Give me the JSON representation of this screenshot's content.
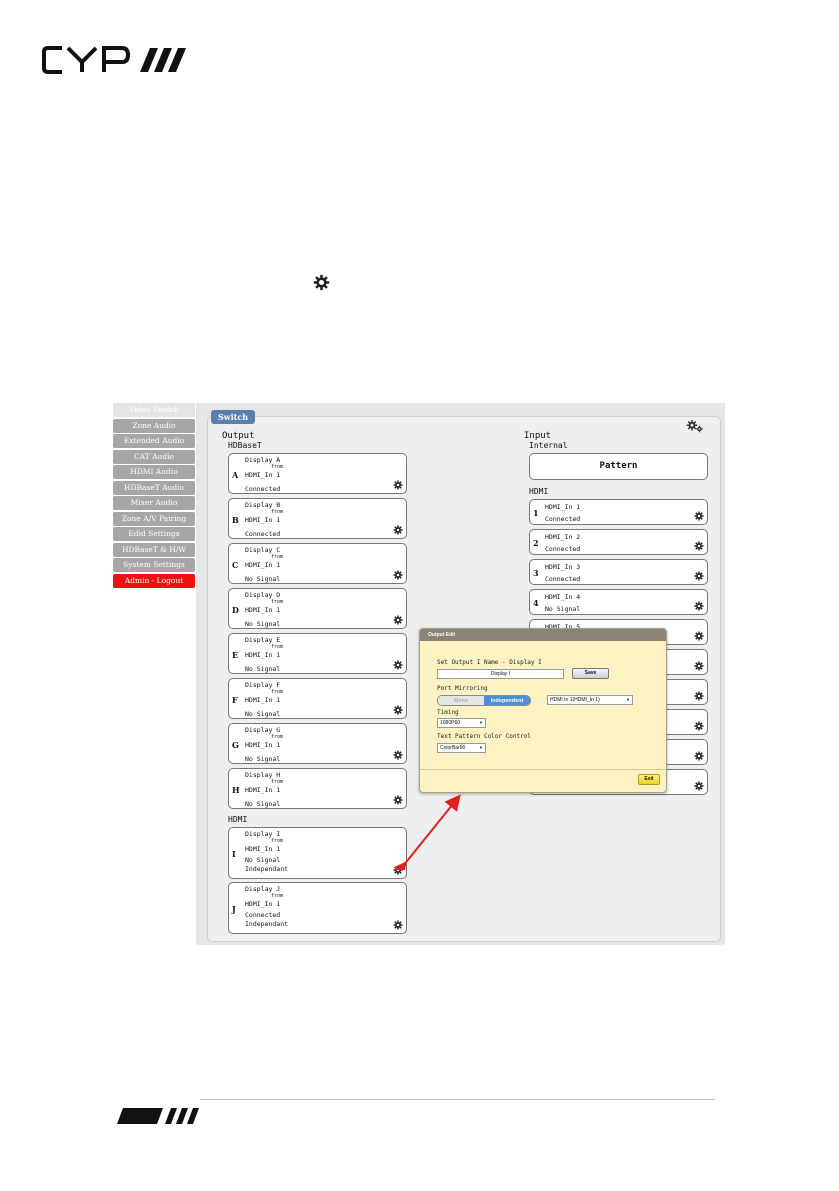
{
  "sidebar": {
    "items": [
      {
        "label": "Video Switch"
      },
      {
        "label": "Zone Audio"
      },
      {
        "label": "Extended Audio"
      },
      {
        "label": "CAT Audio"
      },
      {
        "label": "HDMI Audio"
      },
      {
        "label": "HDBaseT Audio"
      },
      {
        "label": "Mixer Audio"
      },
      {
        "label": "Zone A/V Pairing"
      },
      {
        "label": "Edid Settings"
      },
      {
        "label": "HDBaseT & H/W"
      },
      {
        "label": "System Settings"
      },
      {
        "label": "Admin - Logout"
      }
    ]
  },
  "main": {
    "tab_label": "Switch",
    "output_heading": "Output",
    "hdbaset_heading": "HDBaseT",
    "hdmi_heading": "HDMI",
    "input_heading": "Input",
    "internal_heading": "Internal",
    "input_hdmi_heading": "HDMI",
    "pattern_label": "Pattern"
  },
  "outputs": [
    {
      "letter": "A",
      "name": "Display A",
      "from": "from",
      "source": "HDMI_In 1",
      "status": "Connected",
      "mode": ""
    },
    {
      "letter": "B",
      "name": "Display B",
      "from": "from",
      "source": "HDMI_In 1",
      "status": "Connected",
      "mode": ""
    },
    {
      "letter": "C",
      "name": "Display C",
      "from": "from",
      "source": "HDMI_In 1",
      "status": "No Signal",
      "mode": ""
    },
    {
      "letter": "D",
      "name": "Display D",
      "from": "from",
      "source": "HDMI_In 1",
      "status": "No Signal",
      "mode": ""
    },
    {
      "letter": "E",
      "name": "Display E",
      "from": "from",
      "source": "HDMI_In 1",
      "status": "No Signal",
      "mode": ""
    },
    {
      "letter": "F",
      "name": "Display F",
      "from": "from",
      "source": "HDMI_In 1",
      "status": "No Signal",
      "mode": ""
    },
    {
      "letter": "G",
      "name": "Display G",
      "from": "from",
      "source": "HDMI_In 1",
      "status": "No Signal",
      "mode": ""
    },
    {
      "letter": "H",
      "name": "Display H",
      "from": "from",
      "source": "HDMI_In 1",
      "status": "No Signal",
      "mode": ""
    },
    {
      "letter": "I",
      "name": "Display I",
      "from": "from",
      "source": "HDMI_In 1",
      "status": "No Signal",
      "mode": "Independant"
    },
    {
      "letter": "J",
      "name": "Display J",
      "from": "from",
      "source": "HDMI_In 1",
      "status": "Connected",
      "mode": "Independant"
    }
  ],
  "inputs": [
    {
      "num": "1",
      "name": "HDMI_In 1",
      "status": "Connected"
    },
    {
      "num": "2",
      "name": "HDMI_In 2",
      "status": "Connected"
    },
    {
      "num": "3",
      "name": "HDMI_In 3",
      "status": "Connected"
    },
    {
      "num": "4",
      "name": "HDMI_In 4",
      "status": "No Signal"
    },
    {
      "num": "5",
      "name": "HDMI_In 5",
      "status": ""
    }
  ],
  "popup": {
    "title": "Output Edit",
    "name_label": "Set Output I Name - Display I",
    "name_value": "Display I",
    "save_label": "Save",
    "mirroring_label": "Port Mirroring",
    "mirror_label": "Mirror",
    "independent_label": "Independent",
    "source_select": "HDMI In 1(HDMI_In 1)",
    "timing_label": "Timing",
    "timing_value": "1080P60",
    "color_label": "Text Pattern Color Control",
    "color_value": "ColorBar90",
    "exit_label": "Exit"
  },
  "colors": {
    "brand": "#111111",
    "tab": "#5a7fae",
    "logout": "#ee1111",
    "toggle_active": "#4c8fd6",
    "arrow": "#e02020"
  }
}
